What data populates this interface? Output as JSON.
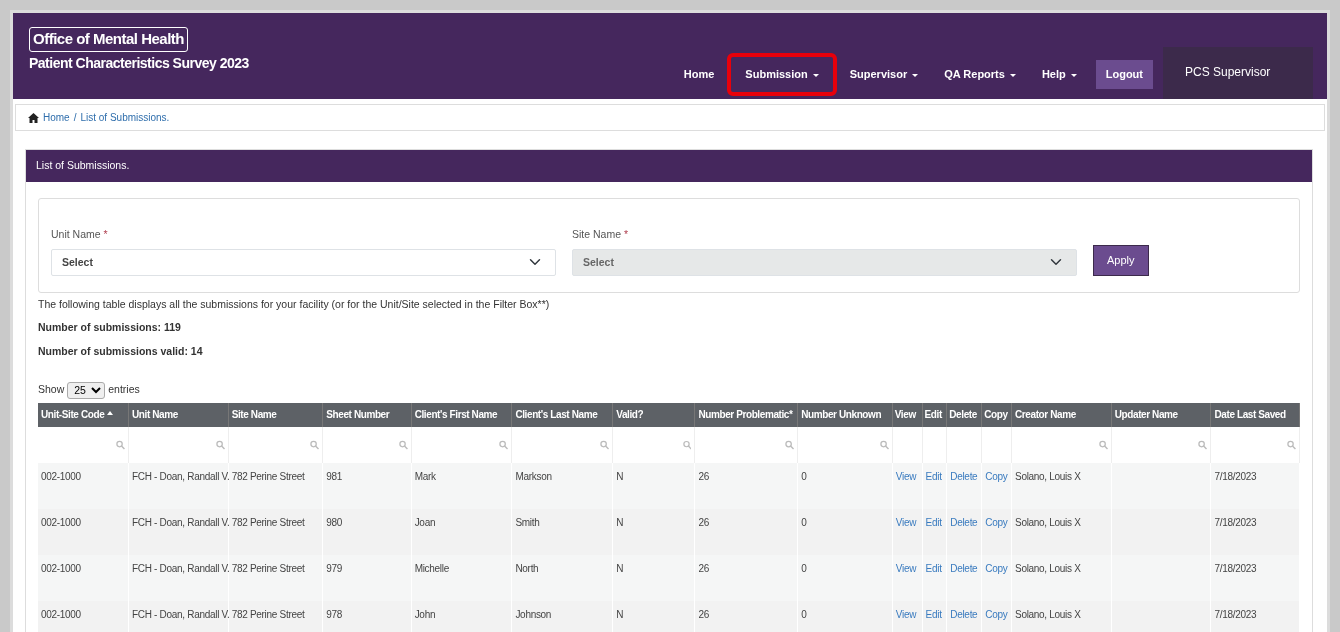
{
  "header": {
    "title": "Office of Mental Health",
    "subtitle": "Patient Characteristics Survey 2023"
  },
  "nav": [
    {
      "label": "Home",
      "dropdown": false,
      "highlighted": false
    },
    {
      "label": "Submission",
      "dropdown": true,
      "highlighted": true
    },
    {
      "label": "Supervisor",
      "dropdown": true,
      "highlighted": false
    },
    {
      "label": "QA Reports",
      "dropdown": true,
      "highlighted": false
    },
    {
      "label": "Help",
      "dropdown": true,
      "highlighted": false
    }
  ],
  "logout": "Logout",
  "user": "PCS Supervisor",
  "breadcrumb": [
    {
      "label": "Home"
    },
    {
      "label": "/"
    },
    {
      "label": "List of Submissions."
    }
  ],
  "panel_title": "List of Submissions.",
  "filters": [
    {
      "label": "Unit Name",
      "required_mark": "*",
      "value": "Select",
      "disabled": false
    },
    {
      "label": "Site Name",
      "required_mark": "*",
      "value": "Select",
      "disabled": true
    }
  ],
  "apply": "Apply",
  "description": "The following table displays all the submissions for your facility (or for the Unit/Site selected in the Filter Box**)",
  "stats": [
    "Number of submissions: 119",
    "Number of submissions valid: 14"
  ],
  "length": {
    "before": "Show",
    "value": "25",
    "after": "entries"
  },
  "table": {
    "columns": [
      {
        "label": "Unit-Site Code",
        "sorted": true,
        "filterable": true,
        "kind": "text"
      },
      {
        "label": "Unit Name",
        "sorted": false,
        "filterable": true,
        "kind": "text"
      },
      {
        "label": "Site Name",
        "sorted": false,
        "filterable": true,
        "kind": "text"
      },
      {
        "label": "Sheet Number",
        "sorted": false,
        "filterable": true,
        "kind": "text"
      },
      {
        "label": "Client's First Name",
        "sorted": false,
        "filterable": true,
        "kind": "text"
      },
      {
        "label": "Client's Last Name",
        "sorted": false,
        "filterable": true,
        "kind": "text"
      },
      {
        "label": "Valid?",
        "sorted": false,
        "filterable": true,
        "kind": "text"
      },
      {
        "label": "Number Problematic*",
        "sorted": false,
        "filterable": true,
        "kind": "text"
      },
      {
        "label": "Number Unknown",
        "sorted": false,
        "filterable": true,
        "kind": "text"
      },
      {
        "label": "View",
        "sorted": false,
        "filterable": false,
        "kind": "link"
      },
      {
        "label": "Edit",
        "sorted": false,
        "filterable": false,
        "kind": "link"
      },
      {
        "label": "Delete",
        "sorted": false,
        "filterable": false,
        "kind": "link"
      },
      {
        "label": "Copy",
        "sorted": false,
        "filterable": false,
        "kind": "link"
      },
      {
        "label": "Creator Name",
        "sorted": false,
        "filterable": true,
        "kind": "text"
      },
      {
        "label": "Updater Name",
        "sorted": false,
        "filterable": true,
        "kind": "text"
      },
      {
        "label": "Date Last Saved",
        "sorted": false,
        "filterable": true,
        "kind": "text"
      }
    ],
    "rows": [
      [
        "002-1000",
        "FCH - Doan, Randall V.",
        "782 Perine Street",
        "981",
        "Mark",
        "Markson",
        "N",
        "26",
        "0",
        "View",
        "Edit",
        "Delete",
        "Copy",
        "Solano, Louis X",
        "",
        "7/18/2023"
      ],
      [
        "002-1000",
        "FCH - Doan, Randall V.",
        "782 Perine Street",
        "980",
        "Joan",
        "Smith",
        "N",
        "26",
        "0",
        "View",
        "Edit",
        "Delete",
        "Copy",
        "Solano, Louis X",
        "",
        "7/18/2023"
      ],
      [
        "002-1000",
        "FCH - Doan, Randall V.",
        "782 Perine Street",
        "979",
        "Michelle",
        "North",
        "N",
        "26",
        "0",
        "View",
        "Edit",
        "Delete",
        "Copy",
        "Solano, Louis X",
        "",
        "7/18/2023"
      ],
      [
        "002-1000",
        "FCH - Doan, Randall V.",
        "782 Perine Street",
        "978",
        "John",
        "Johnson",
        "N",
        "26",
        "0",
        "View",
        "Edit",
        "Delete",
        "Copy",
        "Solano, Louis X",
        "",
        "7/18/2023"
      ]
    ]
  }
}
